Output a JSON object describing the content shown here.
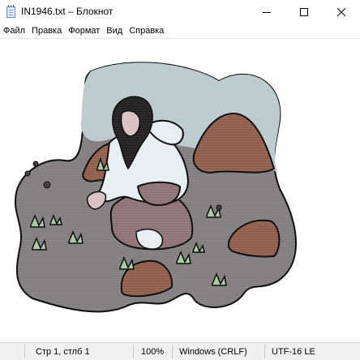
{
  "window": {
    "title": "IN1946.txt – Блокнот",
    "icon": "notepad-icon",
    "controls": [
      "minimize-icon",
      "maximize-icon",
      "close-icon"
    ]
  },
  "menu": {
    "items": [
      "Файл",
      "Правка",
      "Формат",
      "Вид",
      "Справка"
    ]
  },
  "document": {
    "content_description_icon": "ascii-art-image"
  },
  "status": {
    "position": "Стр 1, стлб 1",
    "zoom": "100%",
    "line_endings": "Windows (CRLF)",
    "encoding": "UTF-16 LE"
  },
  "colors": {
    "sky": "#b9c9cc",
    "ground": "#7f7a7c",
    "rock": "#8e5a48",
    "skirt": "#8b6f73",
    "jacket": "#e6eef1",
    "plant": "#a9c9a0"
  }
}
